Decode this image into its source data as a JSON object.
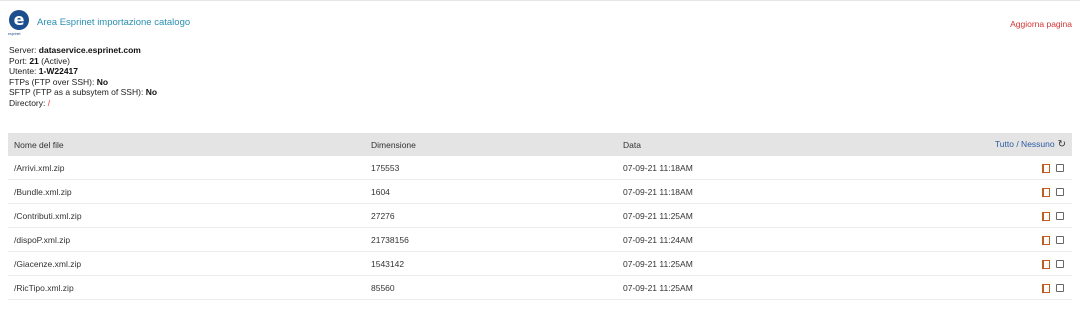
{
  "header": {
    "logo_letter": "e",
    "logo_caption": "esprinet",
    "app_title": "Area Esprinet importazione catalogo",
    "refresh_label": "Aggiorna pagina"
  },
  "connection": {
    "server_label": "Server:",
    "server_value": "dataservice.esprinet.com",
    "port_label": "Port:",
    "port_value": "21",
    "port_status": "(Active)",
    "user_label": "Utente:",
    "user_value": "1-W22417",
    "ftps_label": "FTPs (FTP over SSH):",
    "ftps_value": "No",
    "sftp_label": "SFTP (FTP as a subsytem of SSH):",
    "sftp_value": "No",
    "dir_label": "Directory:",
    "dir_value": "/"
  },
  "table": {
    "headers": {
      "name": "Nome del file",
      "size": "Dimensione",
      "date": "Data",
      "all_none": "Tutto / Nessuno"
    },
    "rows": [
      {
        "name": "/Arrivi.xml.zip",
        "size": "175553",
        "date": "07-09-21 11:18AM"
      },
      {
        "name": "/Bundle.xml.zip",
        "size": "1604",
        "date": "07-09-21 11:18AM"
      },
      {
        "name": "/Contributi.xml.zip",
        "size": "27276",
        "date": "07-09-21 11:25AM"
      },
      {
        "name": "/dispoP.xml.zip",
        "size": "21738156",
        "date": "07-09-21 11:24AM"
      },
      {
        "name": "/Giacenze.xml.zip",
        "size": "1543142",
        "date": "07-09-21 11:25AM"
      },
      {
        "name": "/RicTipo.xml.zip",
        "size": "85560",
        "date": "07-09-21 11:25AM"
      }
    ]
  },
  "icons": {
    "refresh": "refresh-icon",
    "document": "document-icon",
    "checkbox": "checkbox"
  },
  "colors": {
    "brand": "#1c4d8c",
    "title": "#2a8fb0",
    "refresh_link": "#d03434",
    "directory": "#e33333",
    "header_bg": "#e4e4e4"
  }
}
